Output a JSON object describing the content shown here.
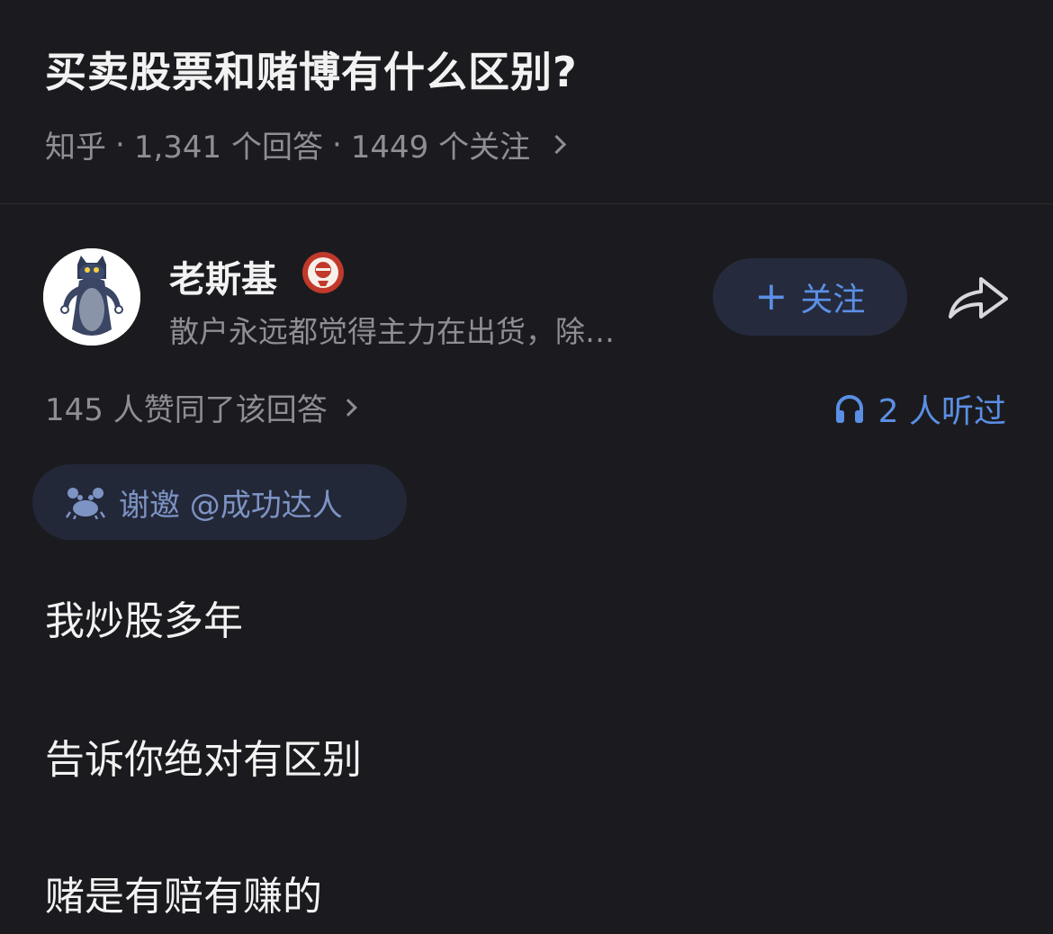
{
  "question": {
    "title": "买卖股票和赌博有什么区别?",
    "source": "知乎",
    "answers": "1,341 个回答",
    "followers": "1449 个关注"
  },
  "author": {
    "name": "老斯基",
    "bio": "散户永远都觉得主力在出货，除…",
    "follow_label": "关注"
  },
  "stats": {
    "upvotes": "145 人赞同了该回答",
    "listens": "2 人听过"
  },
  "invite": {
    "label": "谢邀 @成功达人"
  },
  "content": {
    "paragraphs": [
      "我炒股多年",
      "告诉你绝对有区别",
      "赌是有赔有赚的"
    ]
  },
  "colors": {
    "background": "#1b1b1f",
    "accent_blue": "#5b8fe6",
    "muted_text": "#8e8e93",
    "badge_red": "#c0392b"
  },
  "icons": {
    "badge": "official-badge-icon",
    "share": "share-arrow-icon",
    "listen": "headphones-icon",
    "invite": "crab-icon"
  }
}
